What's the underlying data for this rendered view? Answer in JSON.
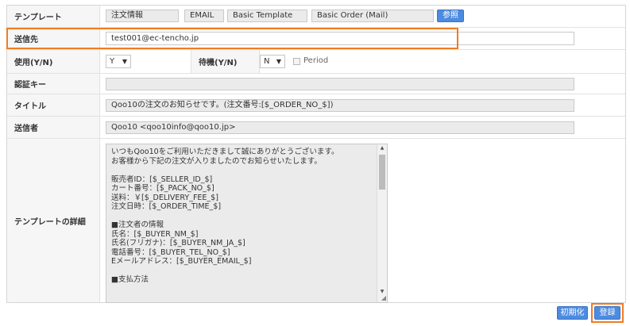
{
  "template_row": {
    "label": "テンプレート",
    "fields": [
      "注文情報",
      "EMAIL",
      "Basic Template",
      "Basic Order (Mail)"
    ],
    "reference_button": "参照"
  },
  "recipient_row": {
    "label": "送信先",
    "value": "test001@ec-tencho.jp"
  },
  "usage_row": {
    "use_label": "使用(Y/N)",
    "use_value": "Y",
    "standby_label": "待機(Y/N)",
    "standby_value": "N",
    "period_label": "Period"
  },
  "auth_row": {
    "label": "認証キー",
    "value": ""
  },
  "title_row": {
    "label": "タイトル",
    "value": "Qoo10の注文のお知らせです。(注文番号:[$_ORDER_NO_$])"
  },
  "sender_row": {
    "label": "送信者",
    "value": "Qoo10 <qoo10info@qoo10.jp>"
  },
  "detail_row": {
    "label": "テンプレートの詳細",
    "lines": [
      "いつもQoo10をご利用いただきまして誠にありがとうございます。",
      "お客様から下記の注文が入りましたのでお知らせいたします。",
      "",
      "販売者ID：[$_SELLER_ID_$]",
      "カート番号：[$_PACK_NO_$]",
      "送料：￥[$_DELIVERY_FEE_$]",
      "注文日時：[$_ORDER_TIME_$]",
      "",
      "■注文者の情報",
      "氏名：[$_BUYER_NM_$]",
      "氏名(フリガナ)：[$_BUYER_NM_JA_$]",
      "電話番号：[$_BUYER_TEL_NO_$]",
      "Eメールアドレス：[$_BUYER_EMAIL_$]",
      "",
      "■支払方法"
    ]
  },
  "footer": {
    "reset_button": "初期化",
    "register_button": "登録"
  },
  "colors": {
    "accent_blue": "#4d8be0",
    "highlight_orange": "#f07c22"
  }
}
